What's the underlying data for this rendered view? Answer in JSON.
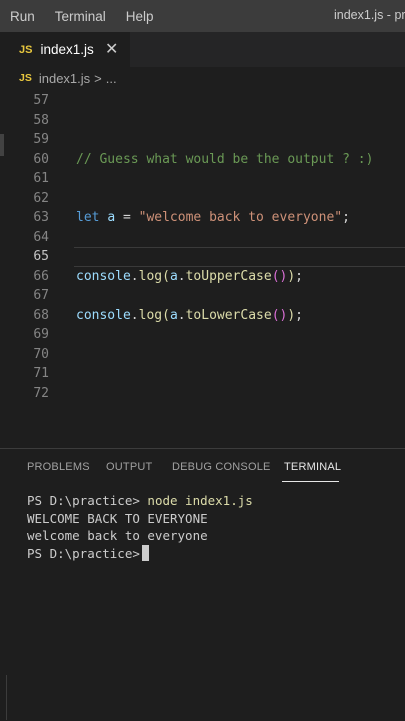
{
  "menubar": {
    "items": [
      "Run",
      "Terminal",
      "Help"
    ],
    "window_title": "index1.js - pr"
  },
  "tab": {
    "badge": "JS",
    "filename": "index1.js",
    "close": "✕"
  },
  "breadcrumb": {
    "badge": "JS",
    "filename": "index1.js",
    "separator": ">",
    "more": "..."
  },
  "editor": {
    "line_numbers": [
      "57",
      "58",
      "59",
      "60",
      "61",
      "62",
      "63",
      "64",
      "65",
      "66",
      "67",
      "68",
      "69",
      "70",
      "71",
      "72"
    ],
    "current_line": "66",
    "code": {
      "comment": "// Guess what would be the output ? :)",
      "let_keyword": "let",
      "var_name": "a",
      "assign": " = ",
      "string": "\"welcome back to everyone\"",
      "semicolon": ";",
      "log1": {
        "obj": "console",
        "dot": ".",
        "fn": "log",
        "open": "(",
        "arg": "a",
        "dot2": ".",
        "method": "toUpperCase",
        "inner": "()",
        "close": ")",
        "end": ";"
      },
      "log2": {
        "obj": "console",
        "dot": ".",
        "fn": "log",
        "open": "(",
        "arg": "a",
        "dot2": ".",
        "method": "toLowerCase",
        "inner": "()",
        "close": ")",
        "end": ";"
      }
    }
  },
  "panel": {
    "tabs": [
      "PROBLEMS",
      "OUTPUT",
      "DEBUG CONSOLE",
      "TERMINAL"
    ],
    "active_tab": "TERMINAL"
  },
  "terminal": {
    "prompt": "PS D:\\practice>",
    "command": "node index1.js",
    "output1": "WELCOME BACK TO EVERYONE",
    "output2": "welcome back to everyone",
    "prompt2": "PS D:\\practice>"
  },
  "colors": {
    "background": "#1e1e1e",
    "comment": "#6a9955",
    "keyword": "#569cd6",
    "string": "#ce9178",
    "function": "#dcdcaa",
    "js_badge": "#e8c73e"
  }
}
